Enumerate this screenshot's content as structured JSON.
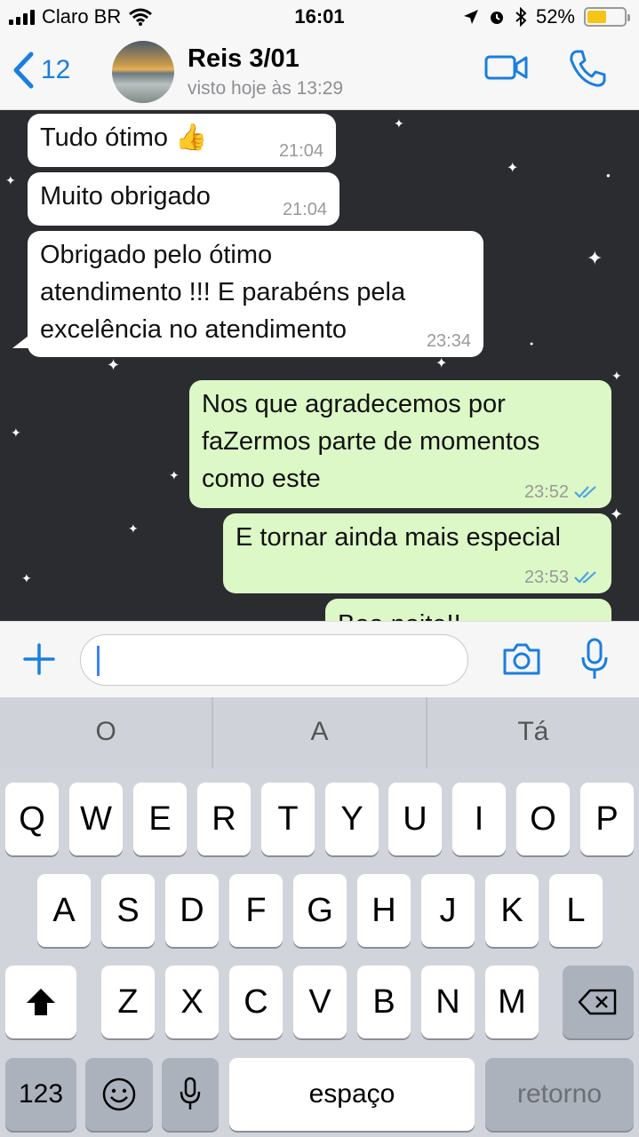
{
  "status_bar": {
    "carrier": "Claro BR",
    "time": "16:01",
    "battery": "52%",
    "battery_level": 0.52
  },
  "header": {
    "back_count": "12",
    "contact_name": "Reis 3/01",
    "contact_status": "visto hoje às 13:29"
  },
  "messages": [
    {
      "direction": "in",
      "text": "Tudo ótimo 👍",
      "time": "21:04"
    },
    {
      "direction": "in",
      "text": "Muito obrigado",
      "time": "21:04"
    },
    {
      "direction": "in",
      "lines": [
        "Obrigado pelo ótimo",
        "atendimento !!! E parabéns pela",
        "excelência no atendimento"
      ],
      "time": "23:34"
    },
    {
      "direction": "out",
      "lines": [
        "Nos que agradecemos por",
        "faZermos parte de momentos",
        "como este"
      ],
      "time": "23:52",
      "status": "read"
    },
    {
      "direction": "out",
      "text": "E tornar ainda mais especial",
      "time": "23:53",
      "status": "read"
    },
    {
      "direction": "out",
      "text": "Boa noite!!",
      "time": ""
    }
  ],
  "input": {
    "value": ""
  },
  "suggestions": [
    "O",
    "A",
    "Tá"
  ],
  "keyboard": {
    "row1": [
      "Q",
      "W",
      "E",
      "R",
      "T",
      "Y",
      "U",
      "I",
      "O",
      "P"
    ],
    "row2": [
      "A",
      "S",
      "D",
      "F",
      "G",
      "H",
      "J",
      "K",
      "L"
    ],
    "row3": [
      "Z",
      "X",
      "C",
      "V",
      "B",
      "N",
      "M"
    ],
    "numbers_key": "123",
    "space_key": "espaço",
    "return_key": "retorno"
  },
  "colors": {
    "accent": "#1a7ee0",
    "incoming_bubble": "#ffffff",
    "outgoing_bubble": "#dcf8c6",
    "chat_background": "#2b2c30",
    "read_ticks": "#4fa3e0"
  }
}
